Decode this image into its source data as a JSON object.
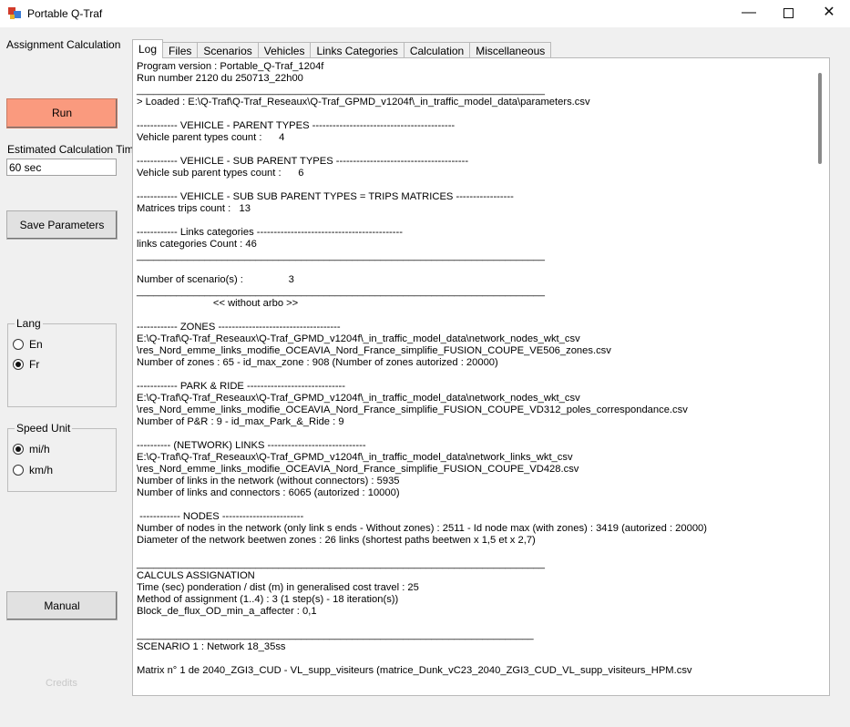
{
  "window": {
    "title": "Portable Q-Traf"
  },
  "left": {
    "heading": "Assignment Calculation",
    "run_label": "Run",
    "est_label": "Estimated Calculation Time",
    "est_value": "60 sec",
    "save_label": "Save Parameters",
    "manual_label": "Manual",
    "credits_label": "Credits"
  },
  "lang": {
    "legend": "Lang",
    "options": [
      {
        "label": "En",
        "checked": false
      },
      {
        "label": "Fr",
        "checked": true
      }
    ]
  },
  "speed": {
    "legend": "Speed Unit",
    "options": [
      {
        "label": "mi/h",
        "checked": true
      },
      {
        "label": "km/h",
        "checked": false
      }
    ]
  },
  "tabs": [
    "Log",
    "Files",
    "Scenarios",
    "Vehicles",
    "Links Categories",
    "Calculation",
    "Miscellaneous"
  ],
  "log": [
    "Program version : Portable_Q-Traf_1204f",
    "Run number 2120 du 250713_22h00",
    "________________________________________________________________________",
    "> Loaded : E:\\Q-Traf\\Q-Traf_Reseaux\\Q-Traf_GPMD_v1204f\\_in_traffic_model_data\\parameters.csv",
    "",
    "------------ VEHICLE - PARENT TYPES ------------------------------------------",
    "Vehicle parent types count :      4",
    "",
    "------------ VEHICLE - SUB PARENT TYPES ---------------------------------------",
    "Vehicle sub parent types count :      6",
    "",
    "------------ VEHICLE - SUB SUB PARENT TYPES = TRIPS MATRICES -----------------",
    "Matrices trips count :   13",
    "",
    "------------ Links categories -------------------------------------------",
    "links categories Count : 46",
    "________________________________________________________________________",
    "",
    "Number of scenario(s) :                3",
    "________________________________________________________________________",
    "                           << without arbo >>",
    "",
    "------------ ZONES ------------------------------------",
    "E:\\Q-Traf\\Q-Traf_Reseaux\\Q-Traf_GPMD_v1204f\\_in_traffic_model_data\\network_nodes_wkt_csv",
    "\\res_Nord_emme_links_modifie_OCEAVIA_Nord_France_simplifie_FUSION_COUPE_VE506_zones.csv",
    "Number of zones : 65 - id_max_zone : 908 (Number of zones autorized : 20000)",
    "",
    "------------ PARK & RIDE -----------------------------",
    "E:\\Q-Traf\\Q-Traf_Reseaux\\Q-Traf_GPMD_v1204f\\_in_traffic_model_data\\network_nodes_wkt_csv",
    "\\res_Nord_emme_links_modifie_OCEAVIA_Nord_France_simplifie_FUSION_COUPE_VD312_poles_correspondance.csv",
    "Number of P&R : 9 - id_max_Park_&_Ride : 9",
    "",
    "---------- (NETWORK) LINKS -----------------------------",
    "E:\\Q-Traf\\Q-Traf_Reseaux\\Q-Traf_GPMD_v1204f\\_in_traffic_model_data\\network_links_wkt_csv",
    "\\res_Nord_emme_links_modifie_OCEAVIA_Nord_France_simplifie_FUSION_COUPE_VD428.csv",
    "Number of links in the network (without connectors) : 5935",
    "Number of links and connectors : 6065 (autorized : 10000)",
    "",
    " ------------ NODES ------------------------",
    "Number of nodes in the network (only link s ends - Without zones) : 2511 - Id node max (with zones) : 3419 (autorized : 20000)",
    "Diameter of the network beetwen zones : 26 links (shortest paths beetwen x 1,5 et x 2,7)",
    "",
    "________________________________________________________________________",
    "CALCULS ASSIGNATION",
    "Time (sec) ponderation / dist (m) in generalised cost travel : 25",
    "Method of assignment (1..4) : 3 (1 step(s) - 18 iteration(s))",
    "Block_de_flux_OD_min_a_affecter : 0,1",
    "",
    "______________________________________________________________________",
    "SCENARIO 1 : Network 18_35ss",
    "",
    "Matrix n° 1 de 2040_ZGI3_CUD - VL_supp_visiteurs (matrice_Dunk_vC23_2040_ZGI3_CUD_VL_supp_visiteurs_HPM.csv"
  ]
}
